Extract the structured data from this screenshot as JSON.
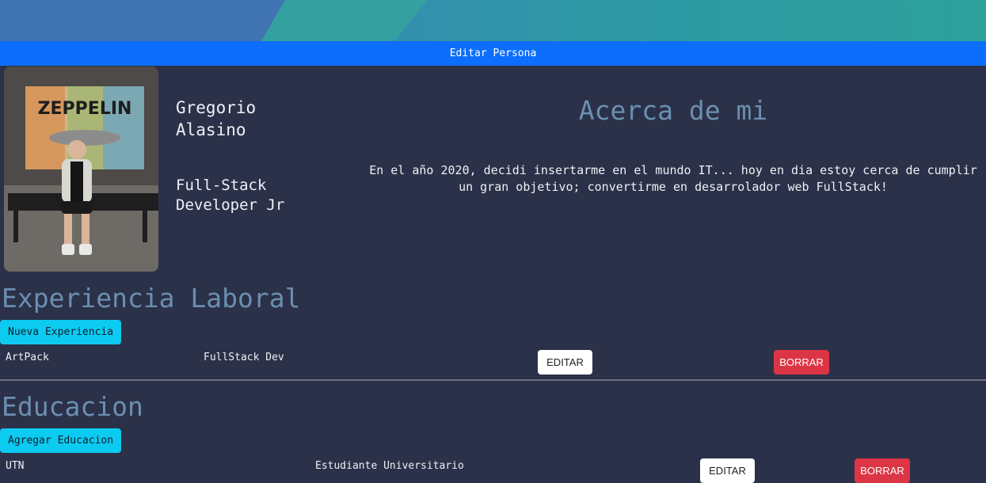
{
  "header": {
    "edit_person_label": "Editar Persona"
  },
  "profile": {
    "first_name": "Gregorio",
    "last_name": "Alasino",
    "title_line1": "Full-Stack",
    "title_line2": "Developer Jr",
    "photo_sign_text": "ZEPPELIN"
  },
  "about": {
    "title": "Acerca de mi",
    "text": "En el año 2020, decidi insertarme en el mundo IT... hoy en dia estoy cerca de cumplir un gran objetivo; convertirme en desarrolador web FullStack!"
  },
  "experience": {
    "title": "Experiencia Laboral",
    "add_label": "Nueva Experiencia",
    "items": [
      {
        "company": "ArtPack",
        "position": "FullStack Dev",
        "edit_label": "EDITAR",
        "delete_label": "BORRAR"
      }
    ]
  },
  "education": {
    "title": "Educacion",
    "add_label": "Agregar Educacion",
    "items": [
      {
        "school": "UTN",
        "degree": "Estudiante Universitario",
        "edit_label": "EDITAR",
        "delete_label": "BORRAR"
      }
    ]
  },
  "colors": {
    "background": "#2b3148",
    "primary": "#0d6efd",
    "info": "#0dcaf0",
    "danger": "#dc3545",
    "heading": "#6b8fb1"
  }
}
